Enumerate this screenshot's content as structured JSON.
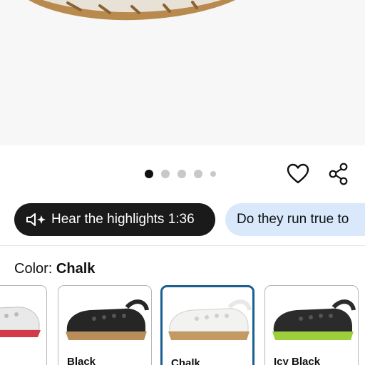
{
  "product": {
    "pager": {
      "total": 5,
      "current": 1
    }
  },
  "actions": {
    "favorite_icon": "heart-outline-icon",
    "share_icon": "share-icon"
  },
  "chips": [
    {
      "label": "Hear the highlights 1:36",
      "icon": "speaker-sparkle-icon"
    },
    {
      "label": "Do they run true to"
    }
  ],
  "color": {
    "label": "Color:",
    "selected": "Chalk"
  },
  "swatches": [
    {
      "name": "phere",
      "color": "#e9e9ea",
      "sole": "#d23a4a",
      "selected": false
    },
    {
      "name": "Black",
      "color": "#262626",
      "sole": "#b98e58",
      "selected": false
    },
    {
      "name": "Chalk",
      "color": "#f2f2f1",
      "sole": "#c49a62",
      "selected": true
    },
    {
      "name": "Icy Black",
      "color": "#2b2b2b",
      "sole": "#9ccf3a",
      "selected": false
    }
  ],
  "colors": {
    "accent_selected": "#1a5f92",
    "chip_dark": "#1a1a1a",
    "chip_light": "#d9e9fb"
  }
}
